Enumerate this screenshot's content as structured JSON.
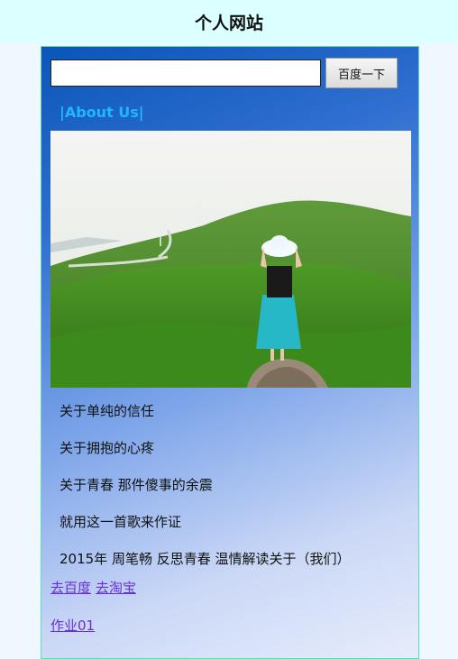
{
  "header": {
    "title": "个人网站"
  },
  "search": {
    "value": "",
    "placeholder": "",
    "button_label": "百度一下"
  },
  "about": {
    "title": "|About Us|"
  },
  "items": [
    "关于单纯的信任",
    "关于拥抱的心疼",
    "关于青春 那件傻事的余震",
    "就用这一首歌来作证",
    "2015年 周笔畅 反思青春 温情解读关于（我们）"
  ],
  "links": [
    "去百度",
    "去淘宝"
  ],
  "homework_link": "作业01",
  "colors": {
    "header_bg": "#dcffff",
    "about_title": "#21b7ff",
    "link": "#6a2fd6",
    "border": "#59e0b3"
  }
}
